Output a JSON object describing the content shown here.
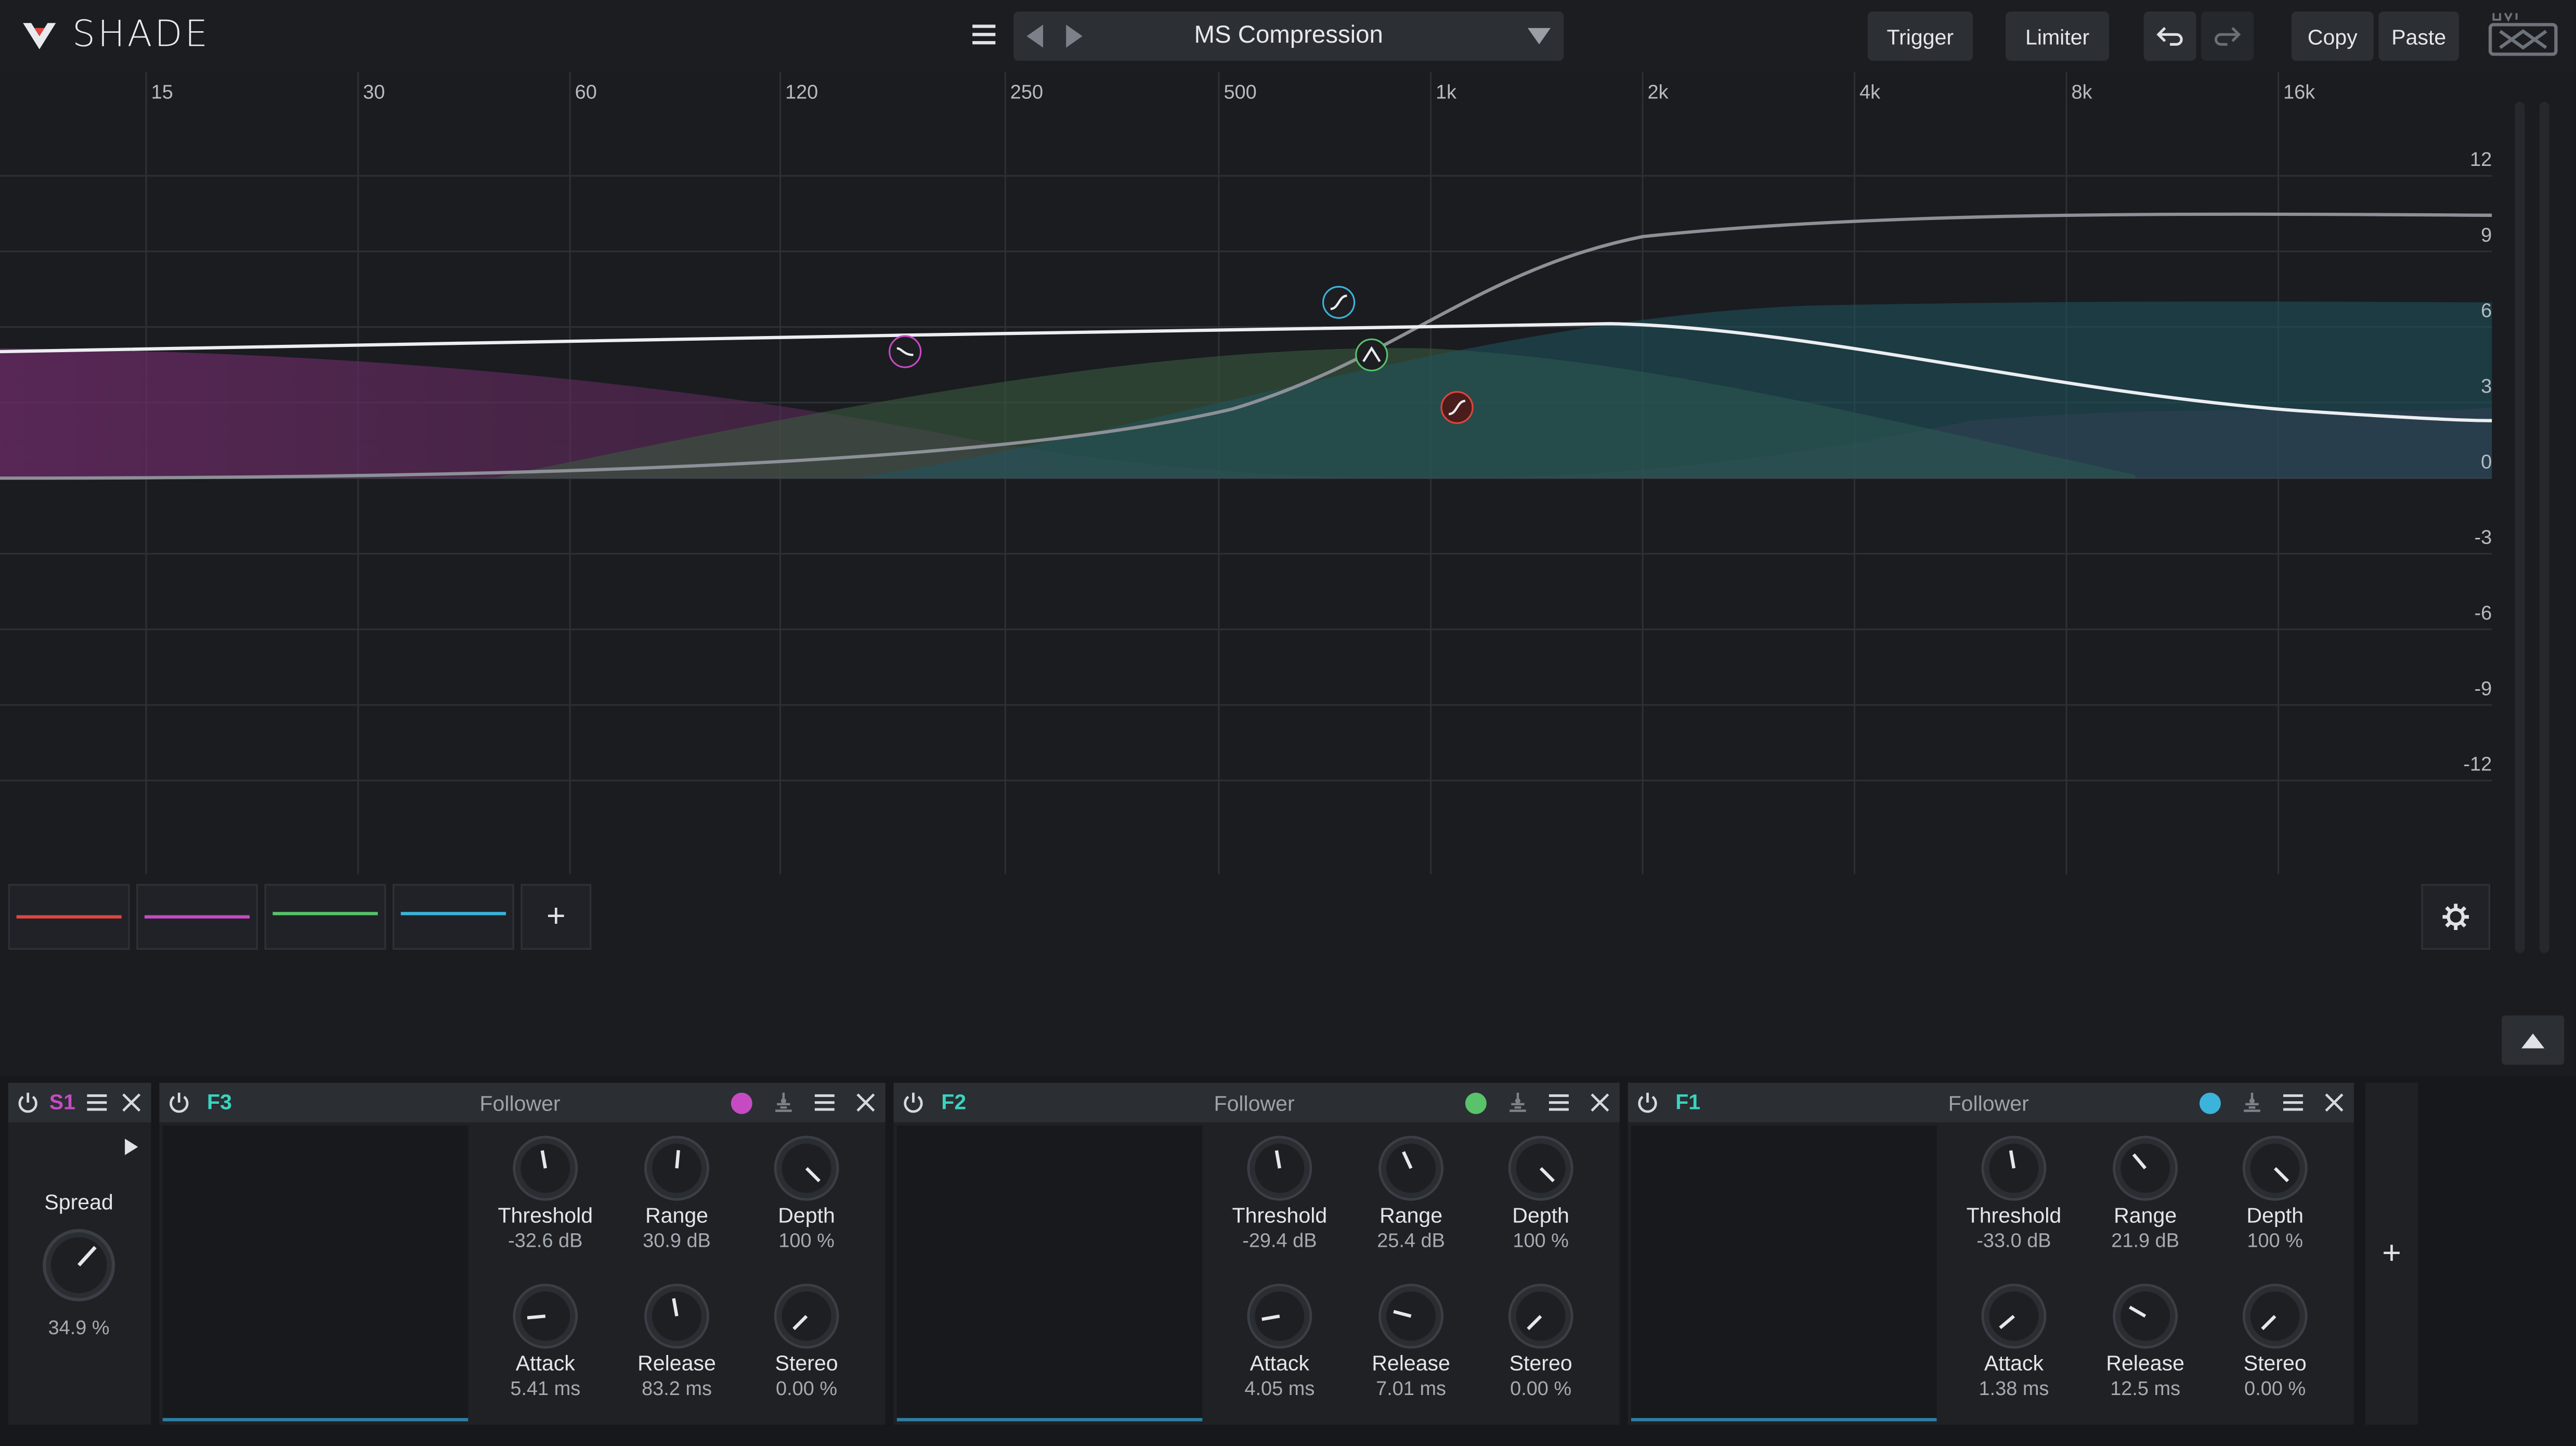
{
  "app": {
    "name": "SHADE"
  },
  "preset": {
    "name": "MS Compression"
  },
  "toolbar": {
    "trigger": "Trigger",
    "limiter": "Limiter",
    "copy": "Copy",
    "paste": "Paste"
  },
  "graph": {
    "freq_labels": [
      "15",
      "30",
      "60",
      "120",
      "250",
      "500",
      "1k",
      "2k",
      "4k",
      "8k",
      "16k"
    ],
    "db_labels": [
      "12",
      "9",
      "6",
      "3",
      "0",
      "-3",
      "-6",
      "-9",
      "-12"
    ]
  },
  "colors": {
    "red": "#e0453c",
    "magenta": "#c64bc3",
    "green": "#59c26a",
    "cyan": "#3cb3da",
    "accent_s1": "#c64bc3",
    "accent_f": "#3ad4c0"
  },
  "bands": [
    {
      "id": "F3",
      "kind": "Follower",
      "color": "#c64bc3",
      "threshold": "-32.6 dB",
      "range": "30.9 dB",
      "depth": "100 %",
      "attack": "5.41 ms",
      "release": "83.2 ms",
      "stereo": "0.00 %"
    },
    {
      "id": "F2",
      "kind": "Follower",
      "color": "#59c26a",
      "threshold": "-29.4 dB",
      "range": "25.4 dB",
      "depth": "100 %",
      "attack": "4.05 ms",
      "release": "7.01 ms",
      "stereo": "0.00 %"
    },
    {
      "id": "F1",
      "kind": "Follower",
      "color": "#3cb3da",
      "threshold": "-33.0 dB",
      "range": "21.9 dB",
      "depth": "100 %",
      "attack": "1.38 ms",
      "release": "12.5 ms",
      "stereo": "0.00 %"
    }
  ],
  "knob_labels": {
    "threshold": "Threshold",
    "range": "Range",
    "depth": "Depth",
    "attack": "Attack",
    "release": "Release",
    "stereo": "Stereo"
  },
  "s1": {
    "id": "S1",
    "spread_label": "Spread",
    "spread_value": "34.9 %"
  },
  "add_symbol": "+"
}
